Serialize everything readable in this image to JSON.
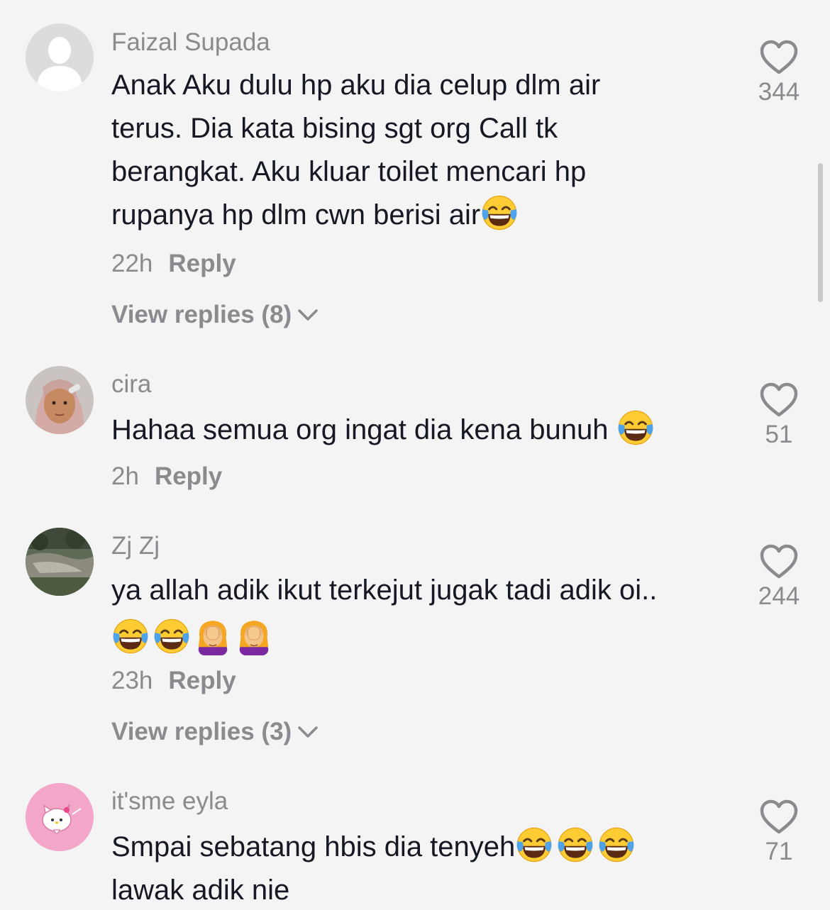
{
  "comments": [
    {
      "username": "Faizal Supada",
      "lines": [
        "Anak Aku dulu hp aku dia celup dlm air",
        "terus. Dia kata bising sgt org Call tk",
        "berangkat. Aku kluar toilet mencari hp",
        "rupanya hp dlm cwn berisi air"
      ],
      "emojis_line4": [
        "face-with-tears-of-joy-emoji"
      ],
      "time": "22h",
      "reply": "Reply",
      "view_replies": "View replies (8)",
      "likes": "344",
      "avatar": "default-avatar-icon"
    },
    {
      "username": "cira",
      "lines": [
        "Hahaa semua org ingat dia kena bunuh "
      ],
      "emojis_line1": [
        "face-with-tears-of-joy-emoji"
      ],
      "time": "2h",
      "reply": "Reply",
      "likes": "51",
      "avatar": "user-photo-avatar"
    },
    {
      "username": "Zj Zj",
      "lines": [
        "ya allah adik ikut terkejut jugak tadi adik oi.."
      ],
      "emojis_line2": [
        "face-with-tears-of-joy-emoji",
        "face-with-tears-of-joy-emoji",
        "woman-facepalming-emoji",
        "woman-facepalming-emoji"
      ],
      "time": "23h",
      "reply": "Reply",
      "view_replies": "View replies (3)",
      "likes": "244",
      "avatar": "landscape-photo-avatar"
    },
    {
      "username": "it'sme eyla",
      "lines": [
        "Smpai sebatang hbis dia tenyeh",
        "lawak adik nie"
      ],
      "emojis_line1": [
        "face-with-tears-of-joy-emoji",
        "face-with-tears-of-joy-emoji",
        "face-with-tears-of-joy-emoji"
      ],
      "likes": "71",
      "avatar": "hello-kitty-avatar"
    }
  ],
  "colors": {
    "background": "#f4f4f4",
    "text": "#161823",
    "muted": "#8a8a8f"
  }
}
